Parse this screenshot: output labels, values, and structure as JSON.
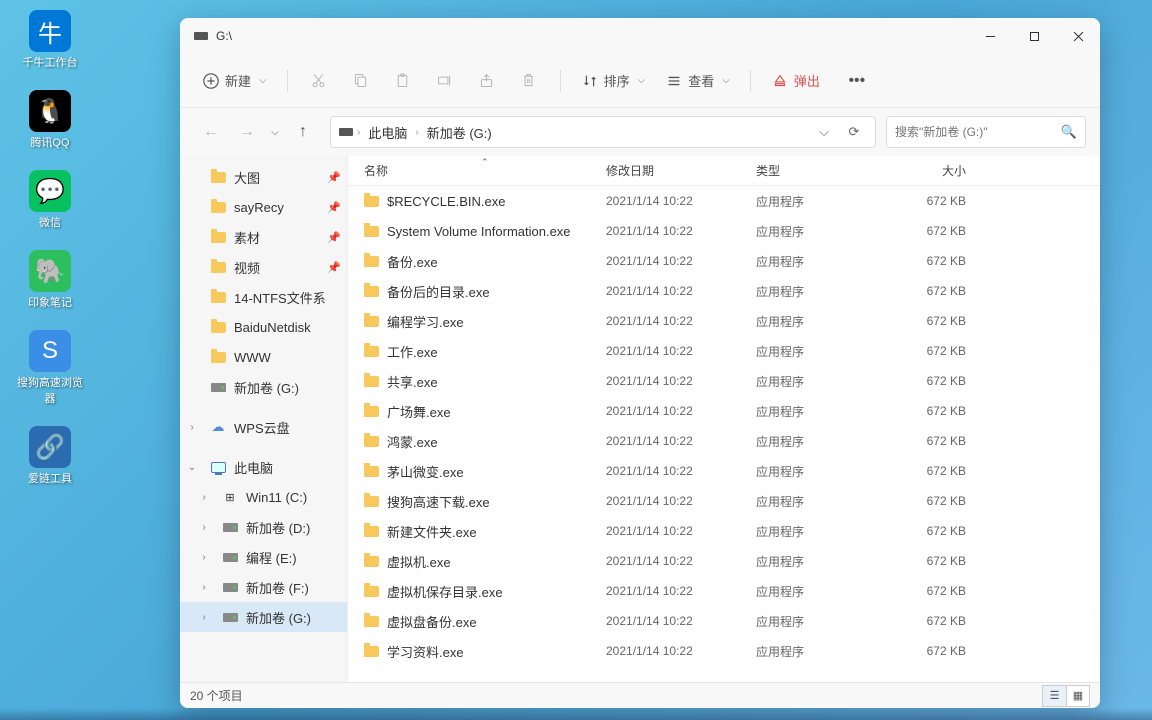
{
  "desktop": [
    {
      "label": "千牛工作台",
      "bg": "#0078d7",
      "glyph": "牛"
    },
    {
      "label": "腾讯QQ",
      "bg": "#000",
      "glyph": "🐧"
    },
    {
      "label": "微信",
      "bg": "#07c160",
      "glyph": "💬"
    },
    {
      "label": "印象笔记",
      "bg": "#2dbe60",
      "glyph": "🐘"
    },
    {
      "label": "搜狗高速浏览器",
      "bg": "#3a8ee6",
      "glyph": "S"
    },
    {
      "label": "爱链工具",
      "bg": "#2b6cb0",
      "glyph": "🔗"
    }
  ],
  "window": {
    "title": "G:\\",
    "toolbar": {
      "new": "新建",
      "sort": "排序",
      "view": "查看",
      "eject": "弹出"
    },
    "breadcrumb": [
      "此电脑",
      "新加卷 (G:)"
    ],
    "search_placeholder": "搜索\"新加卷 (G:)\"",
    "columns": {
      "name": "名称",
      "date": "修改日期",
      "type": "类型",
      "size": "大小"
    },
    "status": "20 个项目"
  },
  "sidebar": {
    "pinned": [
      {
        "label": "大图",
        "icon": "folder",
        "pin": true
      },
      {
        "label": "sayRecy",
        "icon": "folder",
        "pin": true
      },
      {
        "label": "素材",
        "icon": "folder",
        "pin": true
      },
      {
        "label": "视频",
        "icon": "folder",
        "pin": true
      },
      {
        "label": "14-NTFS文件系",
        "icon": "folder"
      },
      {
        "label": "BaiduNetdisk",
        "icon": "folder"
      },
      {
        "label": "WWW",
        "icon": "folder"
      },
      {
        "label": "新加卷 (G:)",
        "icon": "drive"
      }
    ],
    "wps": "WPS云盘",
    "this_pc": "此电脑",
    "drives": [
      {
        "label": "Win11 (C:)",
        "sel": false
      },
      {
        "label": "新加卷 (D:)",
        "sel": false
      },
      {
        "label": "编程 (E:)",
        "sel": false
      },
      {
        "label": "新加卷 (F:)",
        "sel": false
      },
      {
        "label": "新加卷 (G:)",
        "sel": true
      }
    ]
  },
  "files": [
    {
      "name": "$RECYCLE.BIN.exe"
    },
    {
      "name": "System Volume Information.exe"
    },
    {
      "name": "备份.exe"
    },
    {
      "name": "备份后的目录.exe"
    },
    {
      "name": "编程学习.exe"
    },
    {
      "name": "工作.exe"
    },
    {
      "name": "共享.exe"
    },
    {
      "name": "广场舞.exe"
    },
    {
      "name": "鸿蒙.exe"
    },
    {
      "name": "茅山微变.exe"
    },
    {
      "name": "搜狗高速下载.exe"
    },
    {
      "name": "新建文件夹.exe"
    },
    {
      "name": "虚拟机.exe"
    },
    {
      "name": "虚拟机保存目录.exe"
    },
    {
      "name": "虚拟盘备份.exe"
    },
    {
      "name": "学习资料.exe"
    }
  ],
  "file_meta": {
    "date": "2021/1/14 10:22",
    "type": "应用程序",
    "size": "672 KB"
  }
}
